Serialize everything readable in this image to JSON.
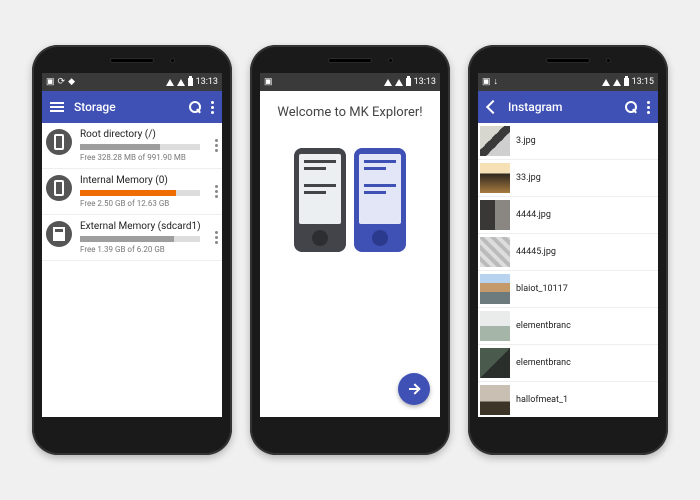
{
  "colors": {
    "primary": "#3f51b5"
  },
  "phone1": {
    "status": {
      "clock": "13:13"
    },
    "appbar": {
      "title": "Storage"
    },
    "items": [
      {
        "title": "Root directory (/)",
        "free": "Free 328.28 MB of 991.90 MB",
        "fill_pct": 67,
        "fill_color": "#9e9e9e",
        "icon": "phone"
      },
      {
        "title": "Internal Memory (0)",
        "free": "Free 2.50 GB of 12.63 GB",
        "fill_pct": 80,
        "fill_color": "#ef6c00",
        "icon": "phone"
      },
      {
        "title": "External Memory (sdcard1)",
        "free": "Free 1.39 GB of 6.20 GB",
        "fill_pct": 78,
        "fill_color": "#9e9e9e",
        "icon": "sd"
      }
    ]
  },
  "phone2": {
    "status": {
      "clock": "13:13"
    },
    "welcome_title": "Welcome to MK Explorer!"
  },
  "phone3": {
    "status": {
      "clock": "13:15"
    },
    "appbar": {
      "title": "Instagram"
    },
    "files": [
      {
        "name": "3.jpg"
      },
      {
        "name": "33.jpg"
      },
      {
        "name": "4444.jpg"
      },
      {
        "name": "44445.jpg"
      },
      {
        "name": "blaiot_10117"
      },
      {
        "name": "elementbranc"
      },
      {
        "name": "elementbranc"
      },
      {
        "name": "hallofmeat_1"
      }
    ]
  }
}
